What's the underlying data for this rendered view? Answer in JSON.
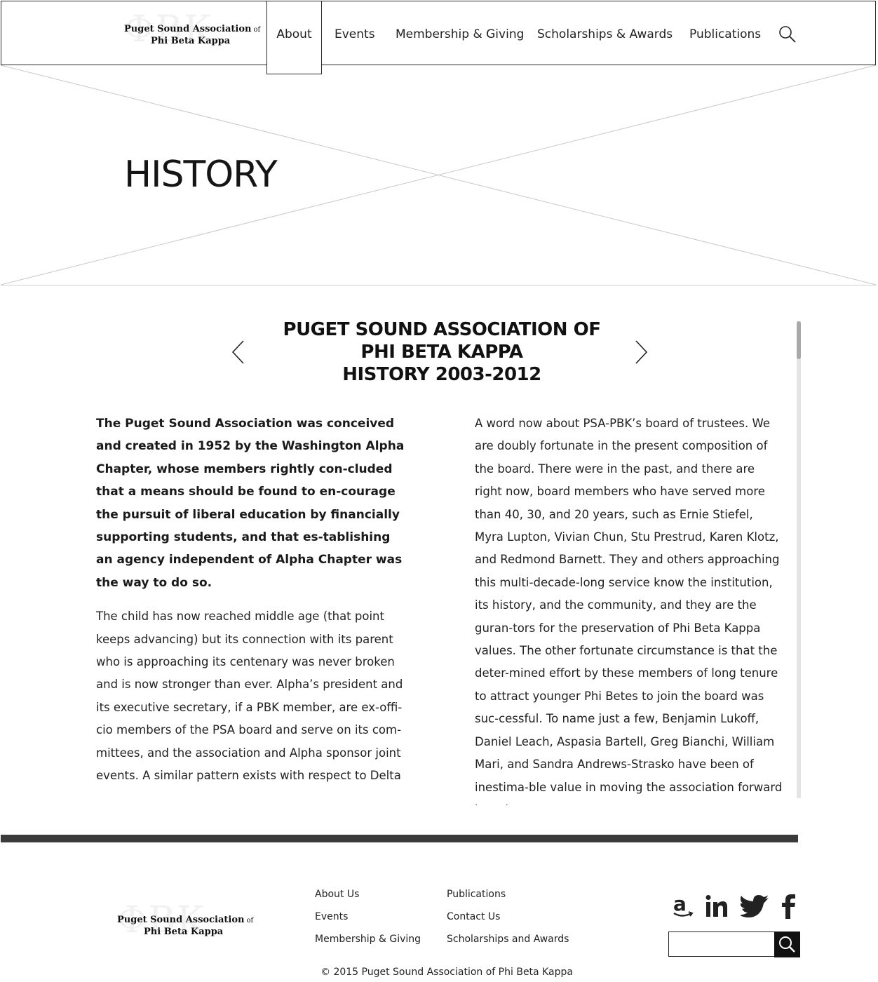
{
  "header": {
    "logo": {
      "line1": "Puget Sound Association",
      "or": "of",
      "line2": "Phi Beta Kappa",
      "watermark": "ΦBK"
    },
    "nav": [
      {
        "label": "About",
        "active": true
      },
      {
        "label": "Events"
      },
      {
        "label": "Membership & Giving"
      },
      {
        "label": "Scholarships & Awards"
      },
      {
        "label": "Publications"
      }
    ],
    "search_icon": "search-icon"
  },
  "hero": {
    "title": "HISTORY"
  },
  "article": {
    "heading_line1": "PUGET SOUND ASSOCIATION OF",
    "heading_line2": "PHI BETA KAPPA",
    "heading_line3": "HISTORY 2003-2012",
    "prev_icon": "chevron-left-icon",
    "next_icon": "chevron-right-icon",
    "lead": "The Puget Sound Association was conceived and created in 1952 by the Washington Alpha Chapter, whose members rightly con-cluded that a means should be found to en-courage the pursuit of liberal education by financially supporting students, and that es-tablishing an agency independent of Alpha Chapter was the way to do so.",
    "left_paragraph": "The child has now reached middle age (that point keeps advancing) but its connection with its parent who is approaching its centenary was never broken and is now stronger than ever. Alpha’s president and its executive secretary, if a PBK member, are ex-offi-cio members of the PSA board and serve on its com-mittees, and the association and Alpha sponsor joint events.  A similar pattern exists with respect to Delta",
    "right_paragraph": "A word now about PSA-PBK’s board of trustees.  We are doubly fortunate in the present composition of the board.  There were in the past, and there are right now, board members who have served more than 40, 30, and 20 years, such as Ernie Stiefel, Myra Lupton, Vivian Chun, Stu Prestrud, Karen Klotz, and Redmond Barnett.  They and others approaching this multi-decade-long service know the institution, its history, and the community, and they are the guran-tors for the preservation of Phi Beta Kappa values. The other fortunate circumstance is that the deter-mined effort by these members of long tenure to attract younger Phi Betes to join the board was suc-cessful.  To name just a few, Benjamin Lukoff, Daniel Leach, Aspasia Bartell, Greg Bianchi, William Mari, and Sandra Andrews-Strasko have been of inestima-ble value in moving the association forward into the"
  },
  "footer": {
    "logo": {
      "line1": "Puget Sound Association",
      "or": "of",
      "line2": "Phi Beta Kappa",
      "watermark": "ΦBK"
    },
    "links_col1": [
      "About Us",
      "Events",
      "Membership & Giving"
    ],
    "links_col2": [
      "Publications",
      "Contact Us",
      "Scholarships and Awards"
    ],
    "social": [
      "amazon-icon",
      "linkedin-icon",
      "twitter-icon",
      "facebook-icon"
    ],
    "search_placeholder": "",
    "copyright": "© 2015 Puget Sound Association of Phi Beta Kappa"
  }
}
